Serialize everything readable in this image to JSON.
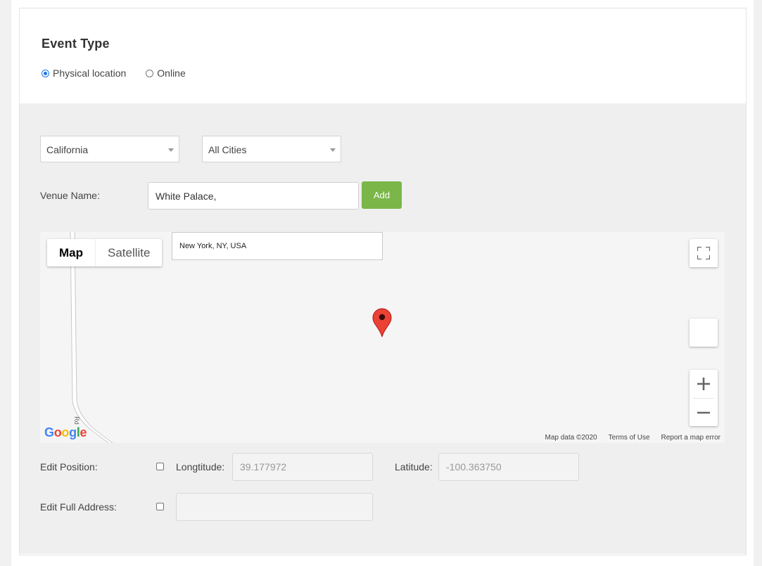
{
  "event_type": {
    "title": "Event Type",
    "options": [
      {
        "label": "Physical location",
        "checked": true
      },
      {
        "label": "Online",
        "checked": false
      }
    ]
  },
  "location": {
    "state_select": "California",
    "city_select": "All Cities",
    "venue_label": "Venue Name:",
    "venue_value": "White Palace, ",
    "add_label": "Add"
  },
  "map": {
    "type_map": "Map",
    "type_satellite": "Satellite",
    "search_value": "New York, NY, USA",
    "road_label": "Rd",
    "logo": "Google",
    "footer": {
      "data": "Map data ©2020",
      "terms": "Terms of Use",
      "report": "Report a map error"
    }
  },
  "position": {
    "edit_position_label": "Edit Position:",
    "longitude_label": "Longtitude:",
    "longitude_value": "39.177972",
    "latitude_label": "Latitude:",
    "latitude_value": "-100.363750",
    "edit_address_label": "Edit Full Address:",
    "address_value": ""
  },
  "colors": {
    "accent_button": "#7ab648",
    "radio_selected": "#1a73e8",
    "marker": "#ea4335"
  }
}
